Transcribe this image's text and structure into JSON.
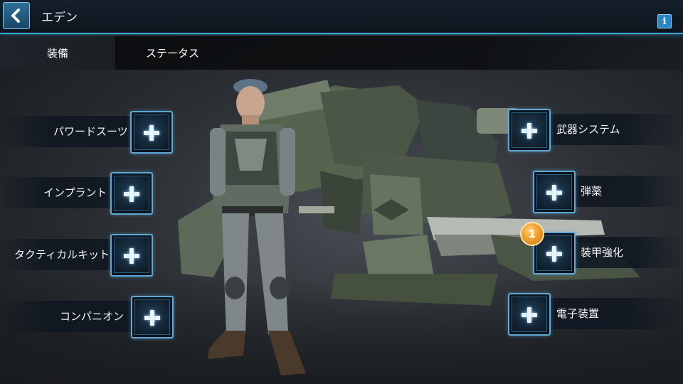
{
  "header": {
    "title": "エデン",
    "back_icon": "chevron-left-icon",
    "info_label": "i"
  },
  "tabs": [
    {
      "label": "装備",
      "active": true
    },
    {
      "label": "ステータス",
      "active": false
    }
  ],
  "left_slots": [
    {
      "label": "パワードスーツ"
    },
    {
      "label": "インプラント"
    },
    {
      "label": "タクティカルキット"
    },
    {
      "label": "コンパニオン"
    }
  ],
  "right_slots": [
    {
      "label": "武器システム"
    },
    {
      "label": "弾薬"
    },
    {
      "label": "装甲強化",
      "badge": "1"
    },
    {
      "label": "電子装置"
    }
  ],
  "colors": {
    "accent": "#3fa7d8",
    "badge": "#f0a030"
  }
}
